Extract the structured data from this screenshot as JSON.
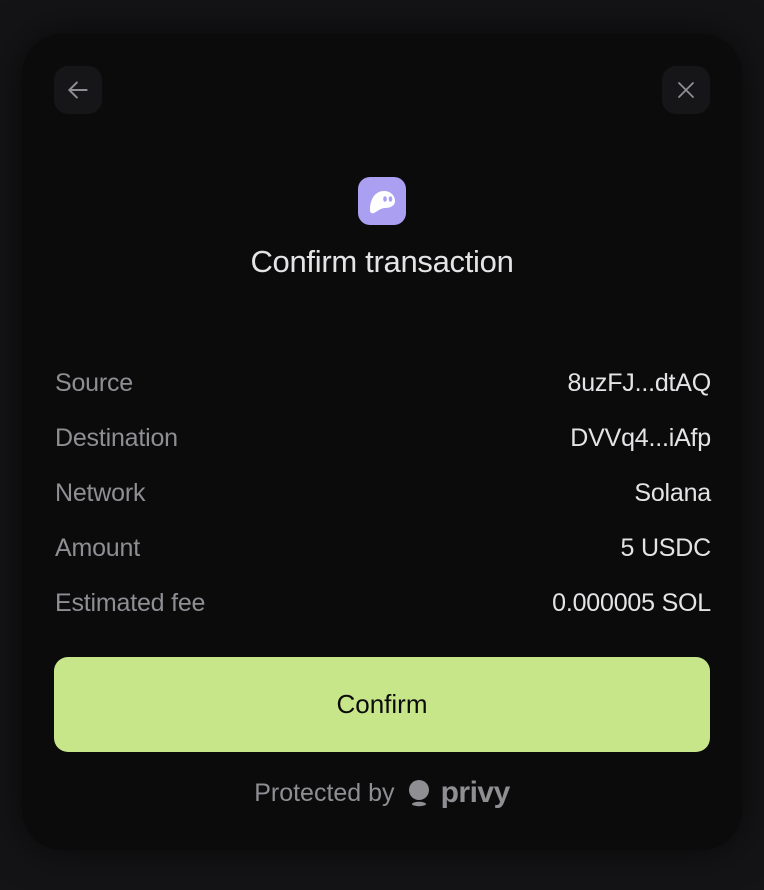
{
  "modal": {
    "title": "Confirm transaction",
    "back_icon": "arrow-left-icon",
    "close_icon": "close-icon",
    "logo_icon": "phantom-ghost-icon",
    "logo_color": "#ab9ff2"
  },
  "details": [
    {
      "label": "Source",
      "value": "8uzFJ...dtAQ"
    },
    {
      "label": "Destination",
      "value": "DVVq4...iAfp"
    },
    {
      "label": "Network",
      "value": "Solana"
    },
    {
      "label": "Amount",
      "value": "5 USDC"
    },
    {
      "label": "Estimated fee",
      "value": "0.000005 SOL"
    }
  ],
  "confirm": {
    "label": "Confirm",
    "color": "#c7e68a"
  },
  "footer": {
    "protected_text": "Protected by",
    "brand_name": "privy",
    "brand_icon": "privy-logo-icon"
  }
}
